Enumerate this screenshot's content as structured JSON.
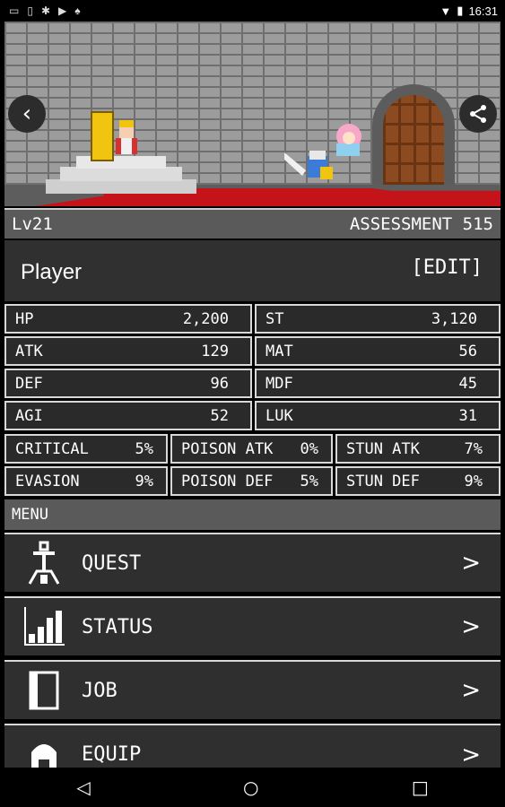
{
  "statusbar": {
    "time": "16:31"
  },
  "level": "Lv21",
  "assessment": "ASSESSMENT 515",
  "player": {
    "name": "Player",
    "edit_label": "[EDIT]"
  },
  "stats": {
    "hp": {
      "label": "HP",
      "value": "2,200"
    },
    "st": {
      "label": "ST",
      "value": "3,120"
    },
    "atk": {
      "label": "ATK",
      "value": "129"
    },
    "mat": {
      "label": "MAT",
      "value": "56"
    },
    "def": {
      "label": "DEF",
      "value": "96"
    },
    "mdf": {
      "label": "MDF",
      "value": "45"
    },
    "agi": {
      "label": "AGI",
      "value": "52"
    },
    "luk": {
      "label": "LUK",
      "value": "31"
    },
    "critical": {
      "label": "CRITICAL",
      "value": "5%"
    },
    "poison_atk": {
      "label": "POISON ATK",
      "value": "0%"
    },
    "stun_atk": {
      "label": "STUN ATK",
      "value": "7%"
    },
    "evasion": {
      "label": "EVASION",
      "value": "9%"
    },
    "poison_def": {
      "label": "POISON DEF",
      "value": "5%"
    },
    "stun_def": {
      "label": "STUN DEF",
      "value": "9%"
    }
  },
  "menu": {
    "title": "MENU",
    "items": [
      {
        "label": "QUEST",
        "icon": "tower-icon"
      },
      {
        "label": "STATUS",
        "icon": "bar-chart-icon"
      },
      {
        "label": "JOB",
        "icon": "book-icon"
      },
      {
        "label": "EQUIP",
        "icon": "helmet-icon"
      }
    ],
    "chevron": ">"
  }
}
